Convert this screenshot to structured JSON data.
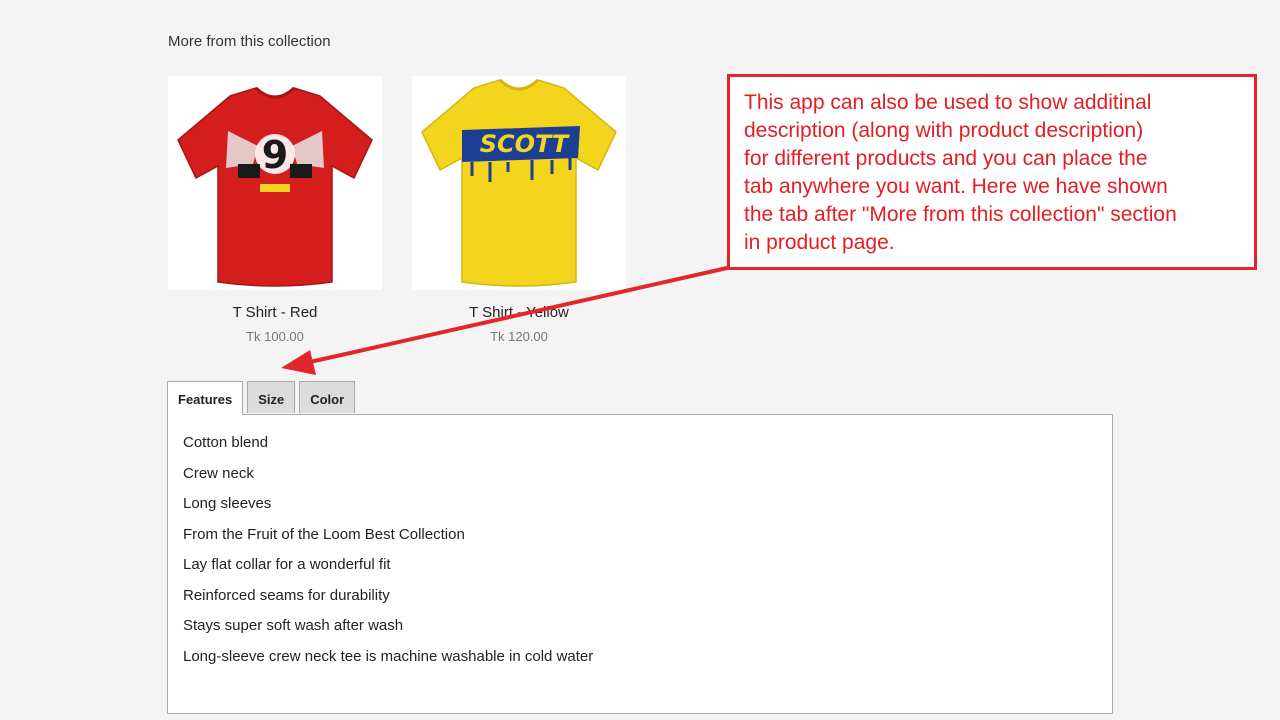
{
  "section": {
    "heading": "More from this collection"
  },
  "products": [
    {
      "name": "T Shirt - Red",
      "price": "Tk 100.00",
      "color": "#d41e1e"
    },
    {
      "name": "T Shirt - Yellow",
      "price": "Tk 120.00",
      "color": "#f2d51c"
    }
  ],
  "tabs": [
    {
      "label": "Features",
      "active": true
    },
    {
      "label": "Size",
      "active": false
    },
    {
      "label": "Color",
      "active": false
    }
  ],
  "features": [
    "Cotton blend",
    "Crew neck",
    "Long sleeves",
    "From the Fruit of the Loom Best Collection",
    "Lay flat collar for a wonderful fit",
    "Reinforced seams for durability",
    "Stays super soft wash after wash",
    "Long-sleeve crew neck tee is machine washable in cold water"
  ],
  "callout": {
    "lines": [
      "This app can also be used to show additinal",
      "description (along with product description)",
      "for different products and you can place the",
      "tab anywhere you want. Here we have shown",
      "the tab after \"More from this collection\" section",
      "in product page."
    ],
    "color": "#e31e24"
  },
  "icons": {
    "red_shirt_graphic": "racing-number-graphic",
    "yellow_shirt_graphic": "scott-logo-graphic",
    "scott_logo_text": "SCOTT"
  }
}
